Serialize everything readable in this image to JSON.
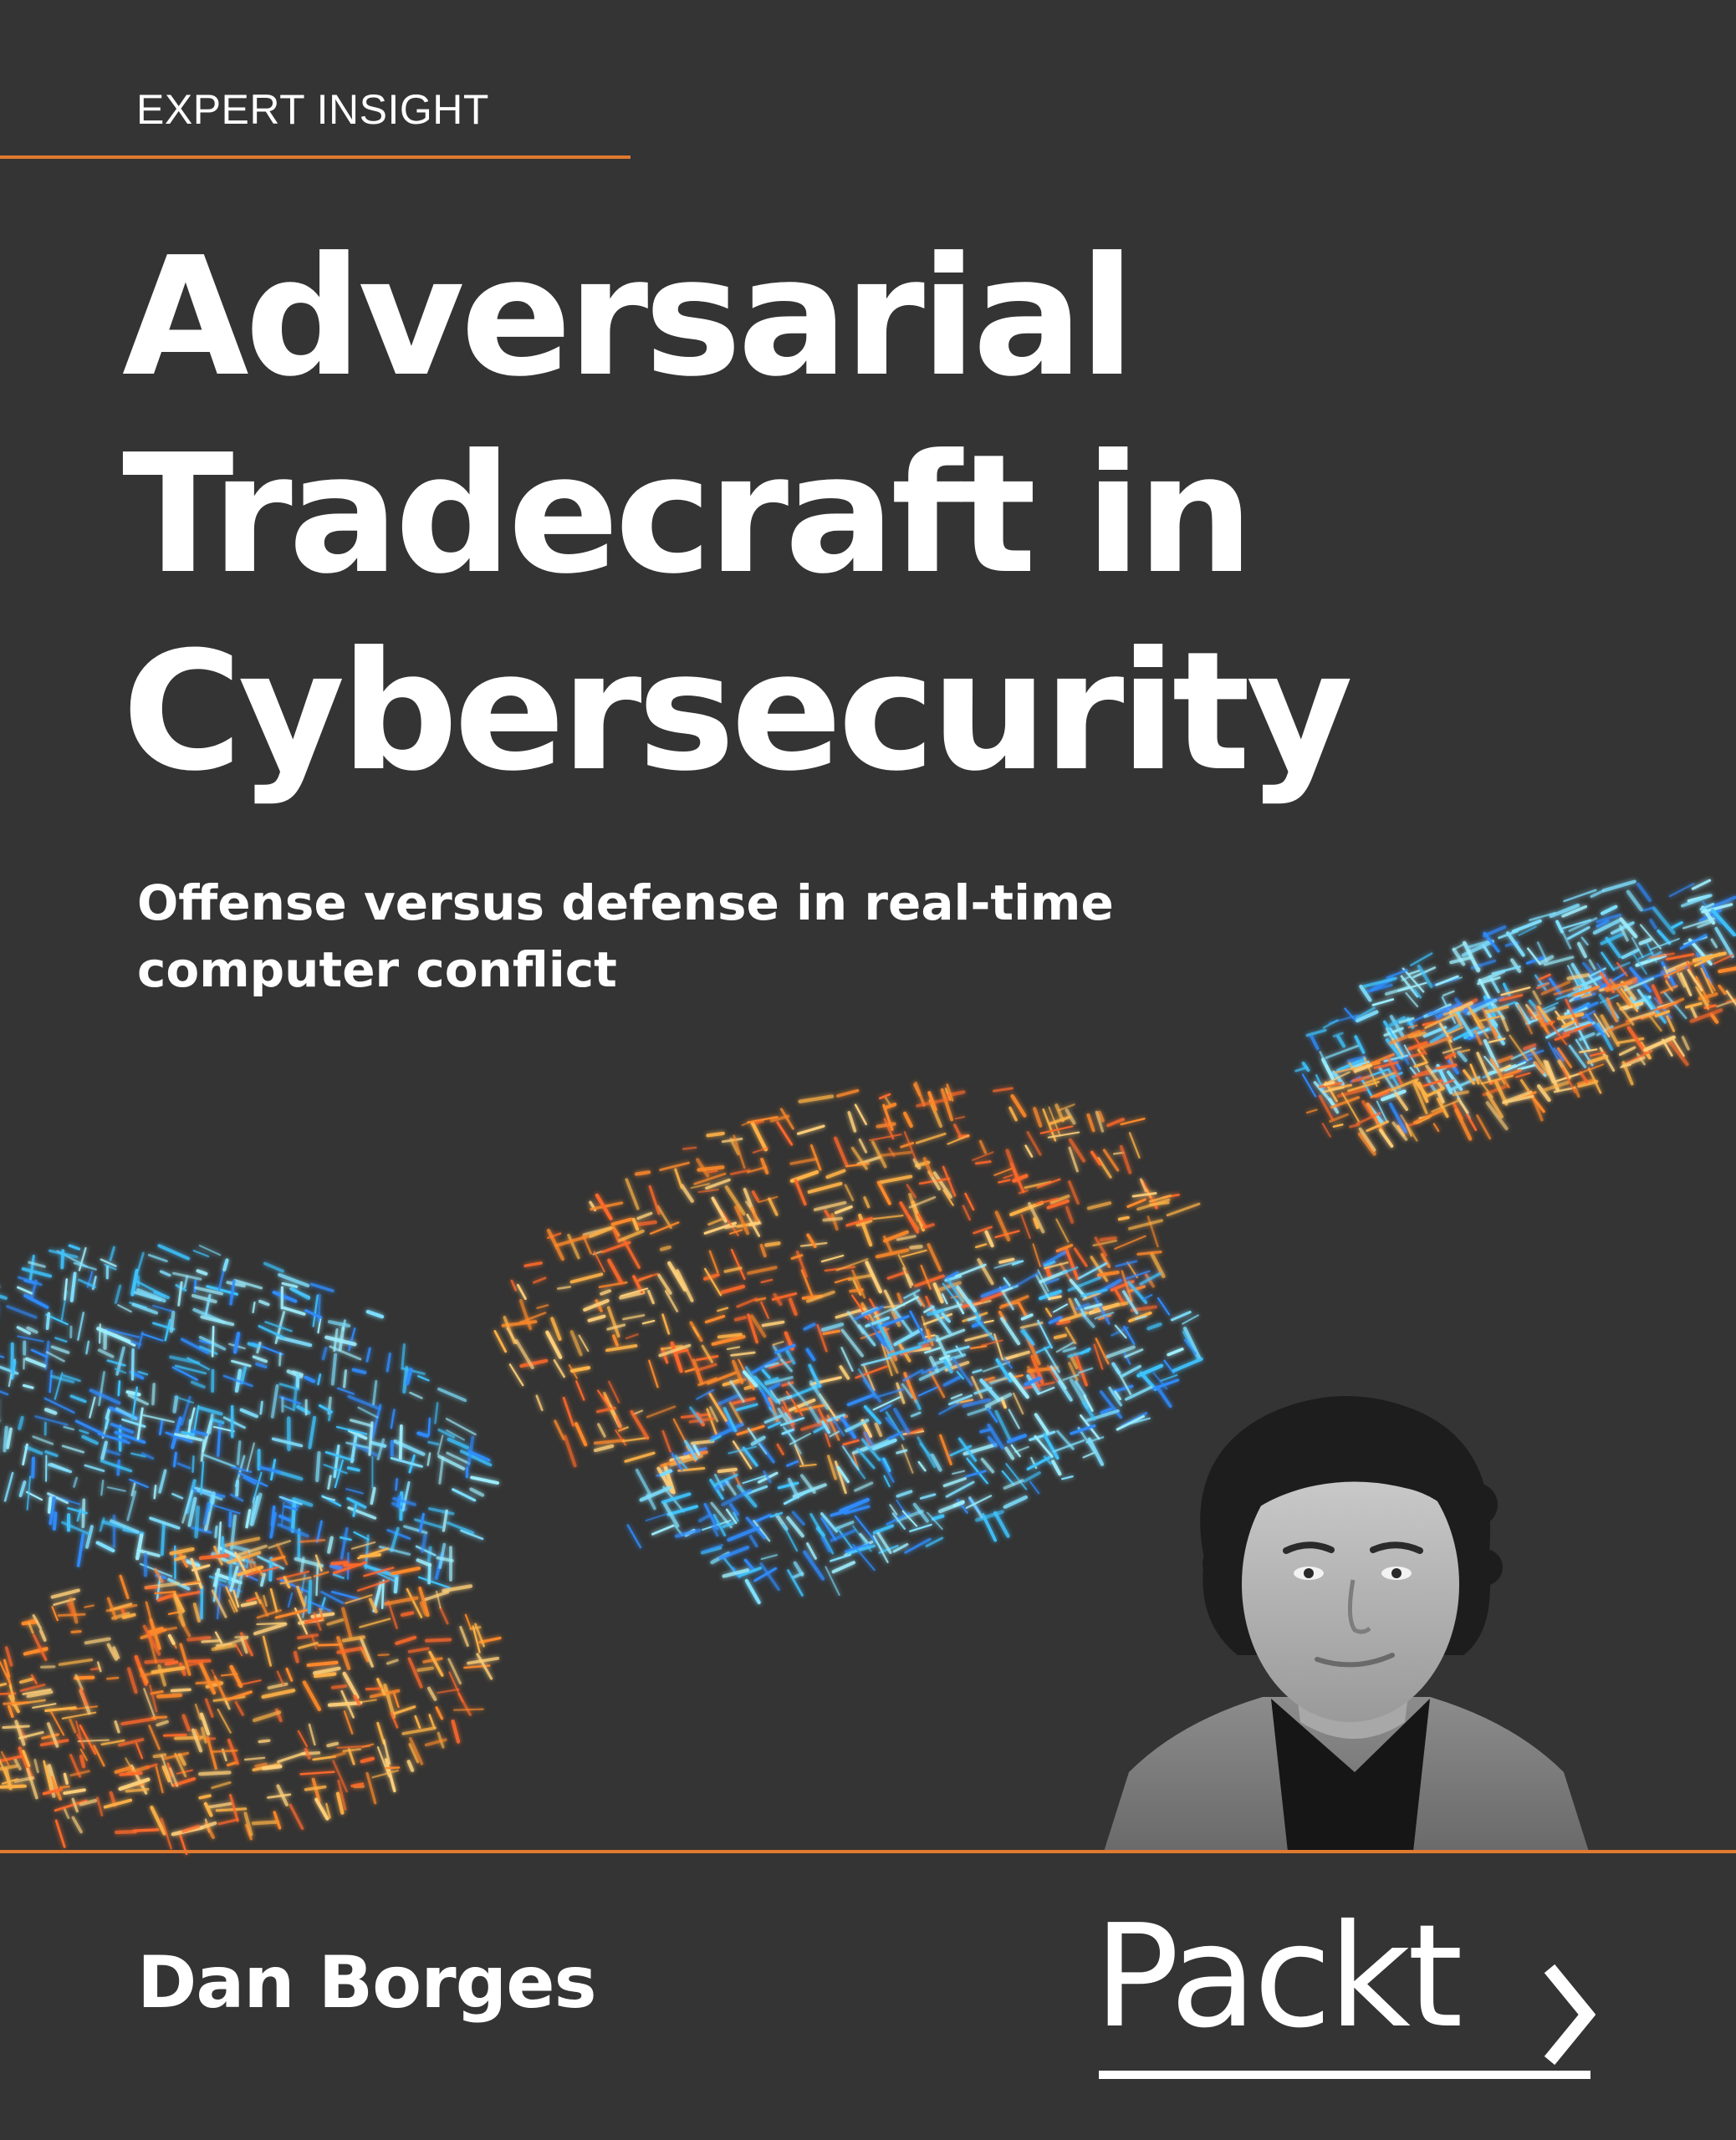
{
  "series": "EXPERT INSIGHT",
  "title": {
    "line1": "Adversarial",
    "line2": "Tradecraft in",
    "line3": "Cybersecurity"
  },
  "subtitle": {
    "line1": "Offense versus defense in real-time",
    "line2": "computer conflict"
  },
  "author": "Dan Borges",
  "publisher": "Packt",
  "colors": {
    "background": "#343434",
    "accent": "#e07a2e",
    "glow_orange": "#ff8a2a",
    "glow_blue": "#3fc4ff"
  }
}
